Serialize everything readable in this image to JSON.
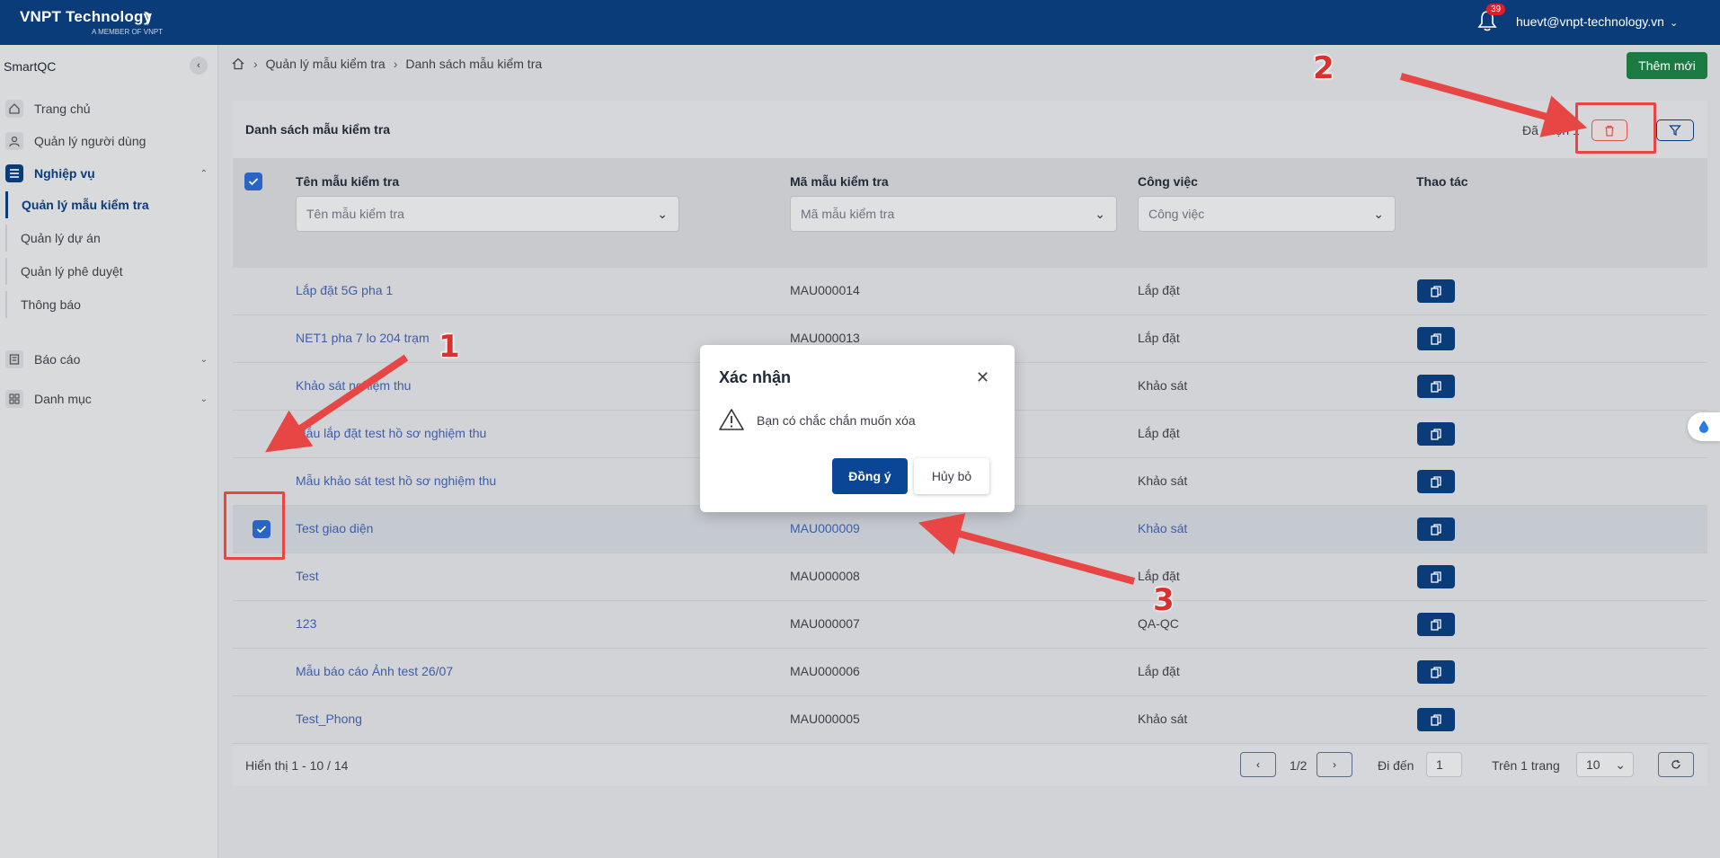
{
  "header": {
    "logo_text": "VNPT Technology",
    "logo_sub": "A MEMBER OF VNPT",
    "notification_count": "39",
    "user_email": "huevt@vnpt-technology.vn"
  },
  "sidebar": {
    "title": "SmartQC",
    "items": [
      {
        "label": "Trang chủ",
        "icon": "home-icon"
      },
      {
        "label": "Quản lý người dùng",
        "icon": "user-icon"
      },
      {
        "label": "Nghiệp vụ",
        "icon": "list-icon"
      },
      {
        "label": "Báo cáo",
        "icon": "report-icon"
      },
      {
        "label": "Danh mục",
        "icon": "grid-icon"
      }
    ],
    "sub_items": [
      {
        "label": "Quản lý mẫu kiểm tra"
      },
      {
        "label": "Quản lý dự án"
      },
      {
        "label": "Quản lý phê duyệt"
      },
      {
        "label": "Thông báo"
      }
    ]
  },
  "breadcrumb": {
    "level1": "Quản lý mẫu kiểm tra",
    "level2": "Danh sách mẫu kiểm tra"
  },
  "toolbar": {
    "add_label": "Thêm mới",
    "selected_text": "Đã chọn 1"
  },
  "table": {
    "title": "Danh sách mẫu kiểm tra",
    "columns": [
      "Tên mẫu kiểm tra",
      "Mã mẫu kiểm tra",
      "Công việc",
      "Thao tác"
    ],
    "filters": {
      "name_placeholder": "Tên mẫu kiểm tra",
      "code_placeholder": "Mã mẫu kiểm tra",
      "job_placeholder": "Công việc"
    },
    "rows": [
      {
        "name": "Lắp đặt 5G pha 1",
        "code": "MAU000014",
        "job": "Lắp đặt"
      },
      {
        "name": "NET1 pha 7 lo 204 trạm",
        "code": "MAU000013",
        "job": "Lắp đặt"
      },
      {
        "name": "Khảo sát nghiệm thu",
        "code": "",
        "job": "Khảo sát"
      },
      {
        "name": "Mẫu lắp đặt test hồ sơ nghiệm thu",
        "code": "",
        "job": "Lắp đặt"
      },
      {
        "name": "Mẫu khảo sát test hồ sơ nghiệm thu",
        "code": "",
        "job": "Khảo sát"
      },
      {
        "name": "Test giao diện",
        "code": "MAU000009",
        "job": "Khảo sát"
      },
      {
        "name": "Test",
        "code": "MAU000008",
        "job": "Lắp đặt"
      },
      {
        "name": "123",
        "code": "MAU000007",
        "job": "QA-QC"
      },
      {
        "name": "Mẫu báo cáo Ảnh test 26/07",
        "code": "MAU000006",
        "job": "Lắp đặt"
      },
      {
        "name": "Test_Phong",
        "code": "MAU000005",
        "job": "Khảo sát"
      }
    ]
  },
  "pagination": {
    "summary": "Hiển thị 1 - 10 / 14",
    "page": "1/2",
    "goto_label": "Đi đến",
    "goto_value": "1",
    "per_page_label": "Trên 1 trang",
    "per_page_value": "10"
  },
  "dialog": {
    "title": "Xác nhận",
    "message": "Bạn có chắc chắn muốn xóa",
    "ok_label": "Đồng ý",
    "cancel_label": "Hủy bỏ"
  },
  "annotations": {
    "step1": "1",
    "step2": "2",
    "step3": "3",
    "color": "#e84545"
  }
}
